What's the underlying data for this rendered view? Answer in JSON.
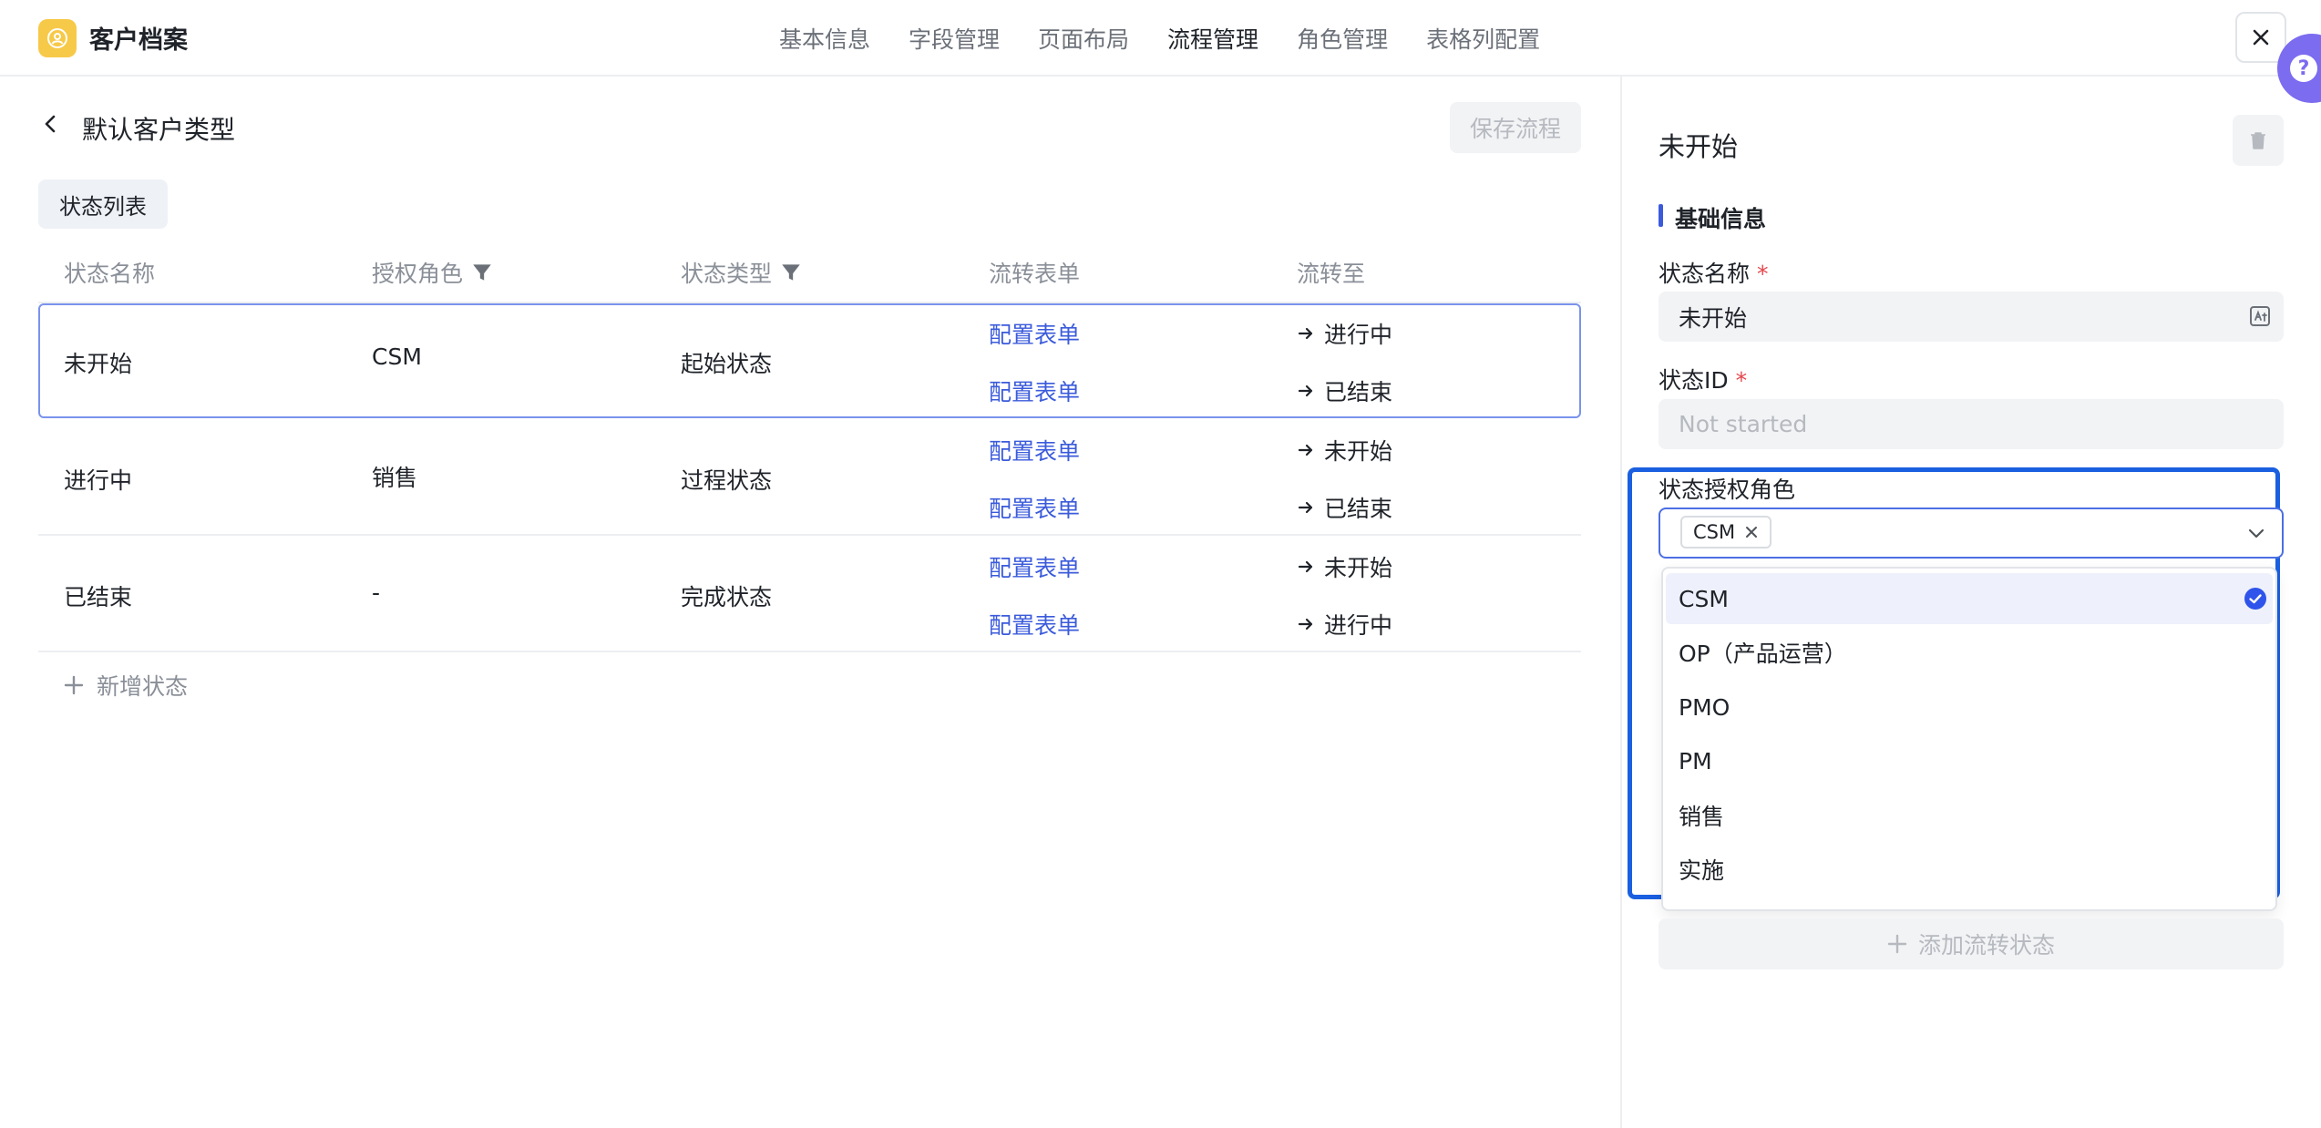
{
  "app": {
    "title": "客户档案"
  },
  "topnav": [
    "基本信息",
    "字段管理",
    "页面布局",
    "流程管理",
    "角色管理",
    "表格列配置"
  ],
  "header": {
    "page_title": "默认客户类型",
    "save_label": "保存流程",
    "tab_label": "状态列表"
  },
  "table": {
    "columns": [
      "状态名称",
      "授权角色",
      "状态类型",
      "流转表单",
      "流转至"
    ],
    "rows": [
      {
        "name": "未开始",
        "role": "CSM",
        "type": "起始状态",
        "forms": [
          "配置表单",
          "配置表单"
        ],
        "targets": [
          "进行中",
          "已结束"
        ]
      },
      {
        "name": "进行中",
        "role": "销售",
        "type": "过程状态",
        "forms": [
          "配置表单",
          "配置表单"
        ],
        "targets": [
          "未开始",
          "已结束"
        ]
      },
      {
        "name": "已结束",
        "role": "-",
        "type": "完成状态",
        "forms": [
          "配置表单",
          "配置表单"
        ],
        "targets": [
          "未开始",
          "进行中"
        ]
      }
    ],
    "add_label": "新增状态"
  },
  "panel": {
    "title": "未开始",
    "section": "基础信息",
    "name_label": "状态名称",
    "name_value": "未开始",
    "id_label": "状态ID",
    "id_placeholder": "Not started",
    "roles_label": "状态授权角色",
    "selected_tag": "CSM",
    "options": [
      "CSM",
      "OP（产品运营）",
      "PMO",
      "PM",
      "销售",
      "实施"
    ],
    "selected_option": "CSM",
    "add_flow_label": "添加流转状态"
  },
  "colors": {
    "accent": "#3b5bdb",
    "highlight": "#1a5fe0",
    "logo": "#f7c948",
    "help": "#7b6cf0"
  }
}
